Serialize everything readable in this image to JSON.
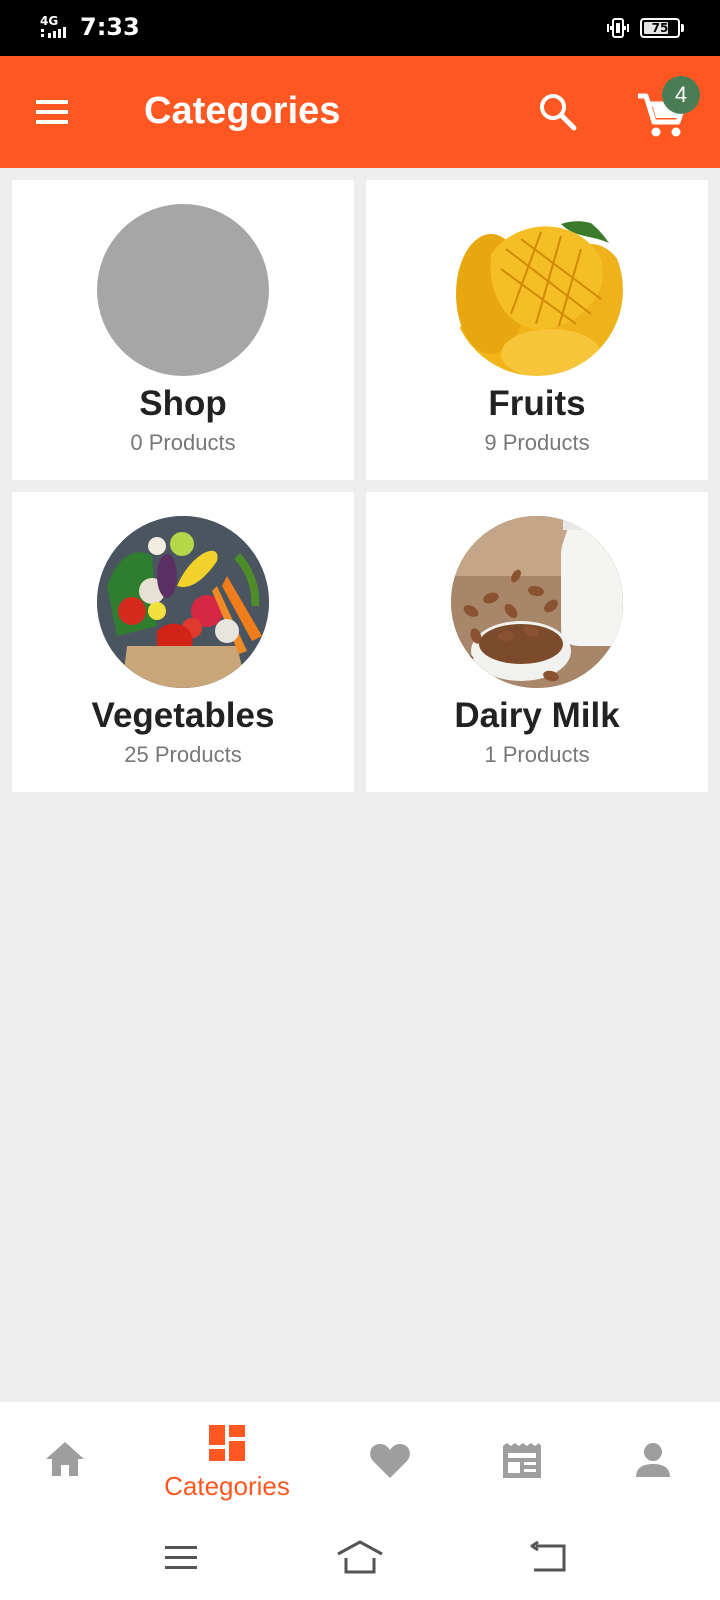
{
  "status_bar": {
    "network": "4G",
    "time": "7:33",
    "battery_percent": "75",
    "battery_level": 0.75
  },
  "app_bar": {
    "title": "Categories",
    "cart_count": "4",
    "icons": [
      "menu-icon",
      "search-icon",
      "cart-icon"
    ]
  },
  "categories": [
    {
      "name": "Shop",
      "count": "0 Products",
      "image": "placeholder-circle"
    },
    {
      "name": "Fruits",
      "count": "9 Products",
      "image": "mango-photo"
    },
    {
      "name": "Vegetables",
      "count": "25 Products",
      "image": "vegetables-photo"
    },
    {
      "name": "Dairy Milk",
      "count": "1 Products",
      "image": "almond-milk-photo"
    }
  ],
  "bottom_nav": {
    "items": [
      {
        "icon": "home-icon",
        "label": "",
        "active": false
      },
      {
        "icon": "categories-icon",
        "label": "Categories",
        "active": true
      },
      {
        "icon": "heart-icon",
        "label": "",
        "active": false
      },
      {
        "icon": "news-icon",
        "label": "",
        "active": false
      },
      {
        "icon": "person-icon",
        "label": "",
        "active": false
      }
    ]
  },
  "system_nav": [
    "menu-icon",
    "home-icon",
    "back-icon"
  ],
  "colors": {
    "primary": "#fe5722",
    "badge": "#4b7d55",
    "background": "#eeeeee",
    "inactive_icon": "#9e9e9e"
  }
}
